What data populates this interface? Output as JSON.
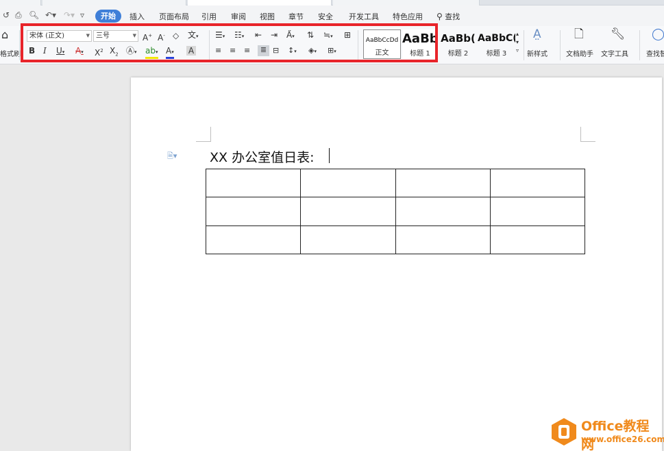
{
  "menubar": {
    "items": [
      "开始",
      "插入",
      "页面布局",
      "引用",
      "审阅",
      "视图",
      "章节",
      "安全",
      "开发工具",
      "特色应用"
    ],
    "search_label": "查找"
  },
  "ribbon": {
    "format_painter_label": "格式刷",
    "font_name": "宋体 (正文)",
    "font_size": "三号",
    "styles": [
      {
        "sample": "AaBbCcDd",
        "name": "正文"
      },
      {
        "sample": "AaBb",
        "name": "标题 1"
      },
      {
        "sample": "AaBb(",
        "name": "标题 2"
      },
      {
        "sample": "AaBbC(",
        "name": "标题 3"
      }
    ],
    "new_style_label": "新样式",
    "doc_helper_label": "文档助手",
    "text_tools_label": "文字工具",
    "find_replace_label": "查找替"
  },
  "document": {
    "title": "XX 办公室值日表:",
    "table": {
      "rows": 3,
      "cols": 4
    }
  },
  "watermark": {
    "title": "Office教程网",
    "url": "www.office26.com"
  },
  "colors": {
    "accent": "#3f7fd8",
    "highlight_frame": "#e8242a",
    "watermark": "#f08a1c"
  }
}
